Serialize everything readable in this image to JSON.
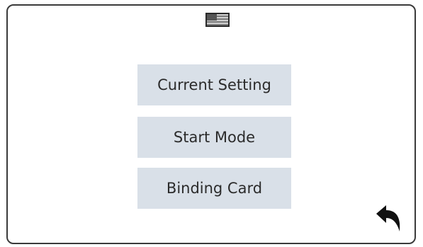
{
  "menu": {
    "items": [
      {
        "label": "Current Setting"
      },
      {
        "label": "Start Mode"
      },
      {
        "label": "Binding Card"
      }
    ]
  },
  "icons": {
    "language": "us-flag-icon",
    "back": "back-arrow-icon"
  },
  "colors": {
    "button_bg": "#d9e0e8",
    "button_text": "#2b2b2b",
    "frame_border": "#3a3a3a",
    "icon": "#111111"
  }
}
